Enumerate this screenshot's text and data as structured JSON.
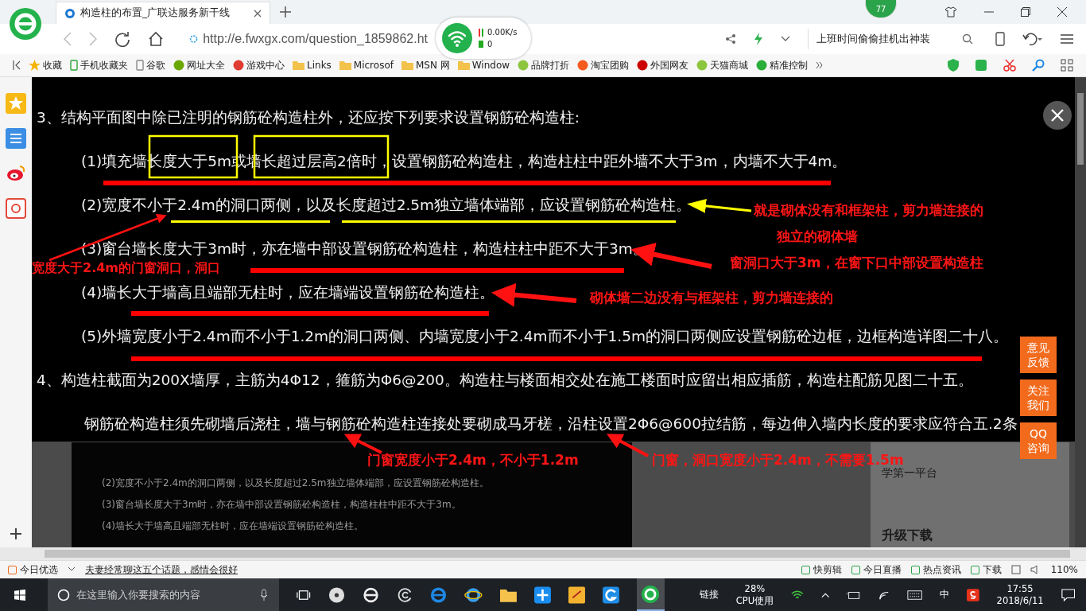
{
  "browser": {
    "tab_title": "构造柱的布置_广联达服务新干线",
    "address": "http://e.fwxgx.com/question_1859862.ht",
    "speed": "0.00K/s",
    "conn_count": "0",
    "badge": "77",
    "search_hint": "上班时间偷偷挂机出神装"
  },
  "bookmarks": [
    {
      "label": "收藏",
      "kind": "star"
    },
    {
      "label": "手机收藏夹",
      "kind": "phone"
    },
    {
      "label": "谷歌",
      "kind": "page"
    },
    {
      "label": "网址大全",
      "kind": "globe"
    },
    {
      "label": "游戏中心",
      "kind": "game"
    },
    {
      "label": "Links",
      "kind": "folder"
    },
    {
      "label": "Microsof",
      "kind": "folder"
    },
    {
      "label": "MSN 网",
      "kind": "folder"
    },
    {
      "label": "Window",
      "kind": "folder"
    },
    {
      "label": "品牌打折",
      "kind": "leaf"
    },
    {
      "label": "淘宝团购",
      "kind": "tao"
    },
    {
      "label": "外国网友",
      "kind": "flag"
    },
    {
      "label": "天猫商城",
      "kind": "leaf"
    },
    {
      "label": "精准控制",
      "kind": "chat"
    }
  ],
  "document": {
    "lines": [
      {
        "kind": "heading",
        "text": "3、结构平面图中除已注明的钢筋砼构造柱外，还应按下列要求设置钢筋砼构造柱:"
      },
      {
        "kind": "item",
        "text": "(1)填充墙长度大于5m或墙长超过层高2倍时，设置钢筋砼构造柱，构造柱柱中距外墙不大于3m，内墙不大于4m。"
      },
      {
        "kind": "item",
        "text": "(2)宽度不小于2.4m的洞口两侧，以及长度超过2.5m独立墙体端部，应设置钢筋砼构造柱。"
      },
      {
        "kind": "item",
        "text": "(3)窗台墙长度大于3m时，亦在墙中部设置钢筋砼构造柱，构造柱柱中距不大于3m。"
      },
      {
        "kind": "item",
        "text": "(4)墙长大于墙高且端部无柱时，应在墙端设置钢筋砼构造柱。"
      },
      {
        "kind": "item",
        "text": "(5)外墙宽度小于2.4m而不小于1.2m的洞口两侧、内墙宽度小于2.4m而不小于1.5m的洞口两侧应设置钢筋砼边框，边框构造详图二十八。"
      },
      {
        "kind": "heading",
        "text": "4、构造柱截面为200X墙厚，主筋为4Φ12，箍筋为Φ6@200。构造柱与楼面相交处在施工楼面时应留出相应插筋，构造柱配筋见图二十五。"
      },
      {
        "kind": "continuation",
        "text": "钢筋砼构造柱须先砌墙后浇柱，墙与钢筋砼构造柱连接处要砌成马牙槎，沿柱设置2Φ6@600拉结筋，每边伸入墙内长度的要求应符合五.2条"
      }
    ]
  },
  "annotations": [
    {
      "text": "就是砌体没有和框架柱，剪力墙连接的"
    },
    {
      "text": "独立的砌体墙"
    },
    {
      "text": "窗洞口大于3m，在窗下口中部设置构造柱"
    },
    {
      "text": "砌体墙二边没有与框架柱，剪力墙连接的"
    },
    {
      "text": "宽度大于2.4m的门窗洞口，洞口"
    },
    {
      "text": "门窗宽度小于2.4m，不小于1.2m"
    },
    {
      "text": "门窗，洞口宽度小于2.4m，不需要1.5m"
    }
  ],
  "side_buttons": [
    "意见反馈",
    "关注我们",
    "QQ咨询"
  ],
  "background_notes": [
    "(2)宽度不小于2.4m的洞口两侧，以及长度超过2.5m独立墙体端部，应设置钢筋砼构造柱。",
    "(3)窗台墙长度大于3m时，亦在墙中部设置钢筋砼构造柱，构造柱柱中距不大于3m。",
    "(4)墙长大于墙高且端部无柱时，应在墙端设置钢筋砼构造柱。"
  ],
  "background_panel": [
    "学第一平台",
    "升级下载"
  ],
  "status_bar": {
    "left": "今日优选",
    "news": "夫妻经常聊这五个话题，感情会很好",
    "items": [
      "快剪辑",
      "今日直播",
      "热点资讯",
      "下载"
    ],
    "zoom": "110%"
  },
  "taskbar": {
    "search_placeholder": "在这里输入你要搜索的内容",
    "links": "链接",
    "cpu": "28%",
    "cpu_label": "CPU使用",
    "ime": "中",
    "time": "17:55",
    "date": "2018/6/11"
  }
}
